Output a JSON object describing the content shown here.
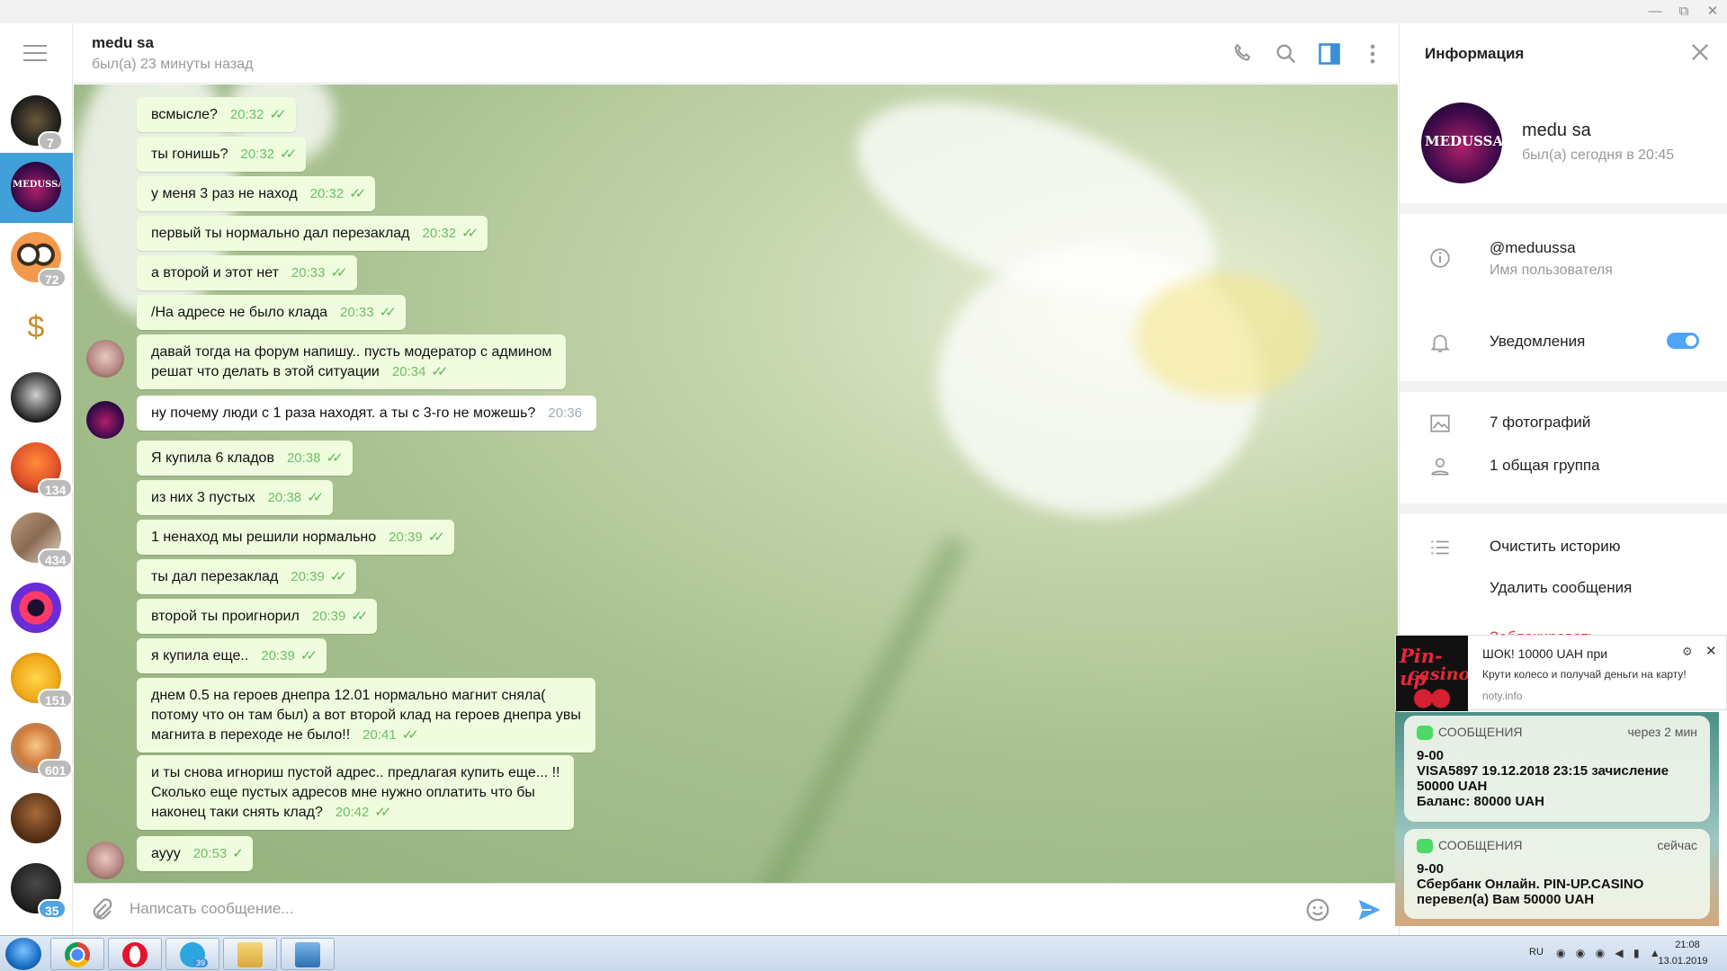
{
  "window": {
    "minimize": "—",
    "restore": "⧉",
    "close": "✕"
  },
  "chat_list": {
    "badges": [
      "7",
      "",
      "72",
      "",
      "",
      "134",
      "434",
      "",
      "151",
      "601",
      "",
      "35"
    ]
  },
  "header": {
    "title": "medu sa",
    "status": "был(а) 23 минуты назад"
  },
  "messages": [
    {
      "text": "всмысле?",
      "time": "20:32"
    },
    {
      "text": "ты гонишь?",
      "time": "20:32"
    },
    {
      "text": "у меня 3 раз не наход",
      "time": "20:32"
    },
    {
      "text": "первый ты нормально дал перезаклад",
      "time": "20:32"
    },
    {
      "text": "а второй и этот нет",
      "time": "20:33"
    },
    {
      "text": "/На адресе не было клада",
      "time": "20:33"
    },
    {
      "text": "давай тогда на форум напишу.. пусть модератор с админом\nрешат что делать в этой ситуации",
      "time": "20:34"
    },
    {
      "text": "ну почему люди с 1 раза находят. а ты с 3-го не можешь?",
      "time": "20:36"
    },
    {
      "text": "Я купила 6 кладов",
      "time": "20:38"
    },
    {
      "text": "из них 3 пустых",
      "time": "20:38"
    },
    {
      "text": "1 ненаход мы решили нормально",
      "time": "20:39"
    },
    {
      "text": "ты дал перезаклад",
      "time": "20:39"
    },
    {
      "text": "второй ты проигнорил",
      "time": "20:39"
    },
    {
      "text": "я купила еще..",
      "time": "20:39"
    },
    {
      "text": "днем 0.5 на героев днепра 12.01 нормально магнит сняла(\nпотому что он там был) а вот второй клад на героев днепра увы\nмагнита в переходе не было!!",
      "time": "20:41"
    },
    {
      "text": "и ты снова игнориш пустой адрес.. предлагая купить еще... !!\nСколько еще пустых адресов мне нужно оплатить что бы\nнаконец таки снять клад?",
      "time": "20:42"
    },
    {
      "text": "аууу",
      "time": "20:53"
    }
  ],
  "composer": {
    "placeholder": "Написать сообщение..."
  },
  "info": {
    "title": "Информация",
    "name": "medu sa",
    "status": "был(а) сегодня в 20:45",
    "username": "@meduussa",
    "username_label": "Имя пользователя",
    "notifications": "Уведомления",
    "photos": "7 фотографий",
    "groups": "1 общая группа",
    "clear_history": "Очистить историю",
    "delete_messages": "Удалить сообщения",
    "block_peek": "Заблокировать"
  },
  "ad": {
    "logo_line1": "Pin-up",
    "logo_line2": "casino",
    "title": "ШОК! 10000 UAH при",
    "text": "Крути колесо и получай деньги на карту!",
    "domain": "noty.info"
  },
  "sms": [
    {
      "app": "СООБЩЕНИЯ",
      "time": "через 2 мин",
      "body": "9-00\nVISA5897 19.12.2018 23:15 зачисление\n50000 UAH\nБаланс: 80000 UAH"
    },
    {
      "app": "СООБЩЕНИЯ",
      "time": "сейчас",
      "body": "9-00\nСбербанк Онлайн. PIN-UP.CASINO\nперевел(а) Вам 50000 UAH"
    }
  ],
  "taskbar": {
    "telegram_badge": "39",
    "lang": "RU",
    "time": "21:08",
    "date": "13.01.2019"
  },
  "avatar_texts": {
    "medussa": "MEDUSSA"
  }
}
